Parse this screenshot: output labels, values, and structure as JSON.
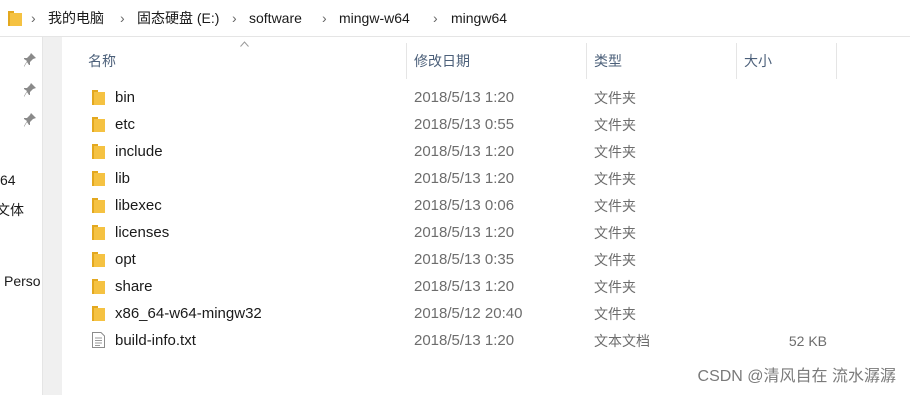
{
  "breadcrumb": {
    "items": [
      "我的电脑",
      "固态硬盘 (E:)",
      "software",
      "mingw-w64",
      "mingw64"
    ],
    "separator": "›"
  },
  "nav": {
    "labels": [
      "64",
      "文体",
      "Perso"
    ]
  },
  "columns": {
    "name": "名称",
    "date": "修改日期",
    "type": "类型",
    "size": "大小"
  },
  "files": [
    {
      "name": "bin",
      "date": "2018/5/13 1:20",
      "type": "文件夹",
      "size": "",
      "icon": "folder-icon"
    },
    {
      "name": "etc",
      "date": "2018/5/13 0:55",
      "type": "文件夹",
      "size": "",
      "icon": "folder-icon"
    },
    {
      "name": "include",
      "date": "2018/5/13 1:20",
      "type": "文件夹",
      "size": "",
      "icon": "folder-icon"
    },
    {
      "name": "lib",
      "date": "2018/5/13 1:20",
      "type": "文件夹",
      "size": "",
      "icon": "folder-icon"
    },
    {
      "name": "libexec",
      "date": "2018/5/13 0:06",
      "type": "文件夹",
      "size": "",
      "icon": "folder-icon"
    },
    {
      "name": "licenses",
      "date": "2018/5/13 1:20",
      "type": "文件夹",
      "size": "",
      "icon": "folder-icon"
    },
    {
      "name": "opt",
      "date": "2018/5/13 0:35",
      "type": "文件夹",
      "size": "",
      "icon": "folder-icon"
    },
    {
      "name": "share",
      "date": "2018/5/13 1:20",
      "type": "文件夹",
      "size": "",
      "icon": "folder-icon"
    },
    {
      "name": "x86_64-w64-mingw32",
      "date": "2018/5/12 20:40",
      "type": "文件夹",
      "size": "",
      "icon": "folder-icon"
    },
    {
      "name": "build-info.txt",
      "date": "2018/5/13 1:20",
      "type": "文本文档",
      "size": "52 KB",
      "icon": "text-file-icon"
    }
  ],
  "watermark": "CSDN @清风自在 流水潺潺",
  "colors": {
    "folder": "#f5c242",
    "folder_dark": "#e3a81f",
    "header_text": "#4c607a",
    "meta_text": "#6d6d6d"
  }
}
